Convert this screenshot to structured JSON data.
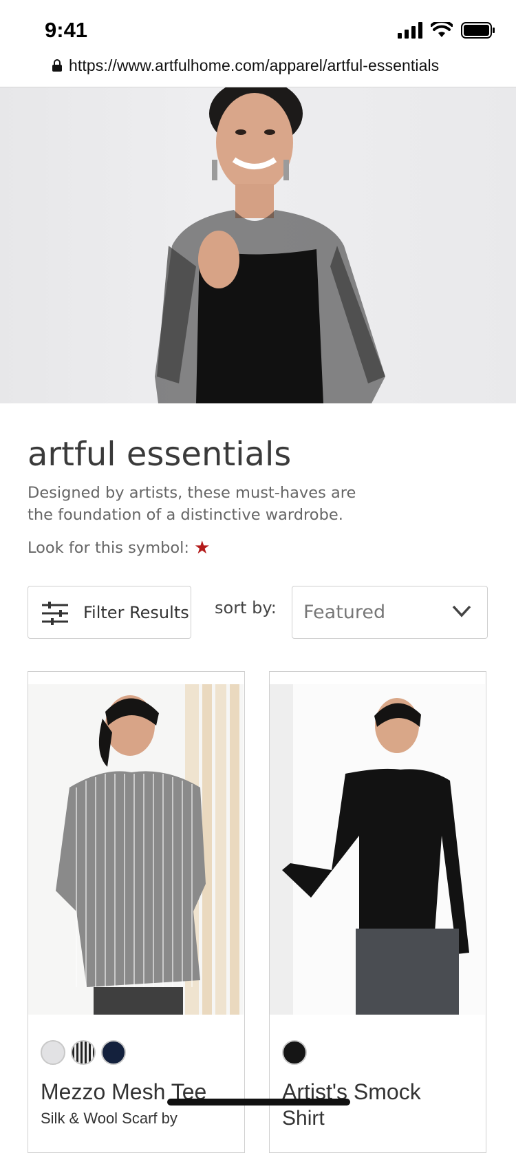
{
  "status_bar": {
    "time": "9:41"
  },
  "browser": {
    "url": "https://www.artfulhome.com/apparel/artful-essentials"
  },
  "hero": {
    "image": "model-black-mesh-top"
  },
  "header": {
    "title": "artful essentials",
    "description": "Designed by artists, these must-haves are the foundation of a distinctive wardrobe.",
    "symbol_text": "Look for this symbol:",
    "symbol_icon": "star-icon",
    "symbol_color": "#b31b1b"
  },
  "controls": {
    "filter_label": "Filter Results",
    "sort_label": "sort by:",
    "sort_value": "Featured"
  },
  "products": [
    {
      "title": "Mezzo Mesh Tee",
      "subtitle": "Silk & Wool Scarf by",
      "swatches": [
        "#e2e2e4",
        "stripe",
        "#14213d"
      ]
    },
    {
      "title": "Artist's Smock",
      "subtitle": "Shirt",
      "swatches": [
        "#151515"
      ]
    }
  ]
}
